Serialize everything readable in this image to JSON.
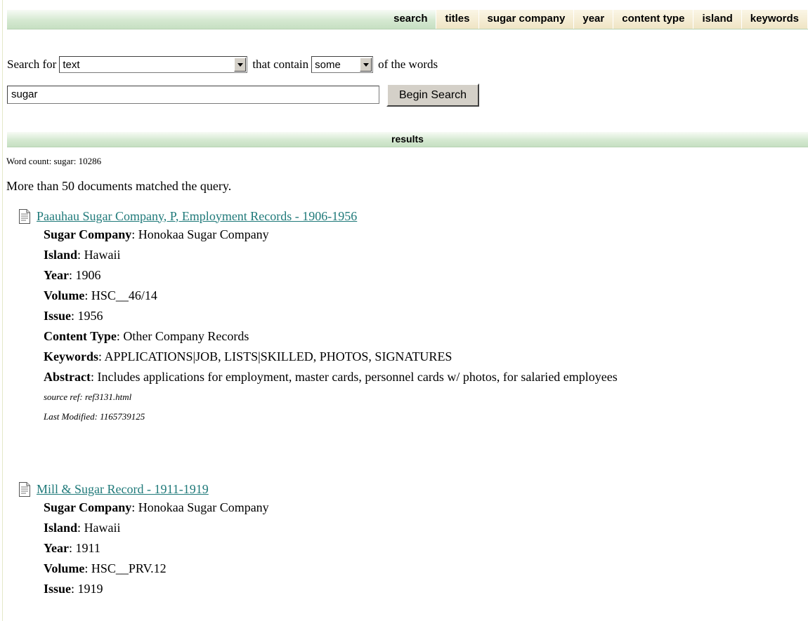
{
  "nav": {
    "items": [
      "search",
      "titles",
      "sugar company",
      "year",
      "content type",
      "island",
      "keywords"
    ]
  },
  "search": {
    "search_for_label": "Search for",
    "field_select": "text",
    "that_contain_label": "that contain",
    "match_select": "some",
    "of_the_words_label": "of the words",
    "query": "sugar",
    "button_label": "Begin Search"
  },
  "results": {
    "header": "results",
    "word_count": "Word count: sugar: 10286",
    "matched_text": "More than 50 documents matched the query."
  },
  "labels": {
    "sugar_company": "Sugar Company",
    "island": "Island",
    "year": "Year",
    "volume": "Volume",
    "issue": "Issue",
    "content_type": "Content Type",
    "keywords": "Keywords",
    "abstract": "Abstract"
  },
  "records": [
    {
      "title": "Paauhau Sugar Company, P, Employment Records - 1906-1956",
      "sugar_company": "Honokaa Sugar Company",
      "island": "Hawaii",
      "year": "1906",
      "volume": "HSC__46/14",
      "issue": "1956",
      "content_type": "Other Company Records",
      "keywords": "APPLICATIONS|JOB, LISTS|SKILLED, PHOTOS, SIGNATURES",
      "abstract": "Includes applications for employment, master cards, personnel cards w/ photos, for salaried employees",
      "source_ref": "source ref: ref3131.html",
      "last_modified": "Last Modified: 1165739125"
    },
    {
      "title": "Mill & Sugar Record - 1911-1919",
      "sugar_company": "Honokaa Sugar Company",
      "island": "Hawaii",
      "year": "1911",
      "volume": "HSC__PRV.12",
      "issue": "1919"
    }
  ]
}
